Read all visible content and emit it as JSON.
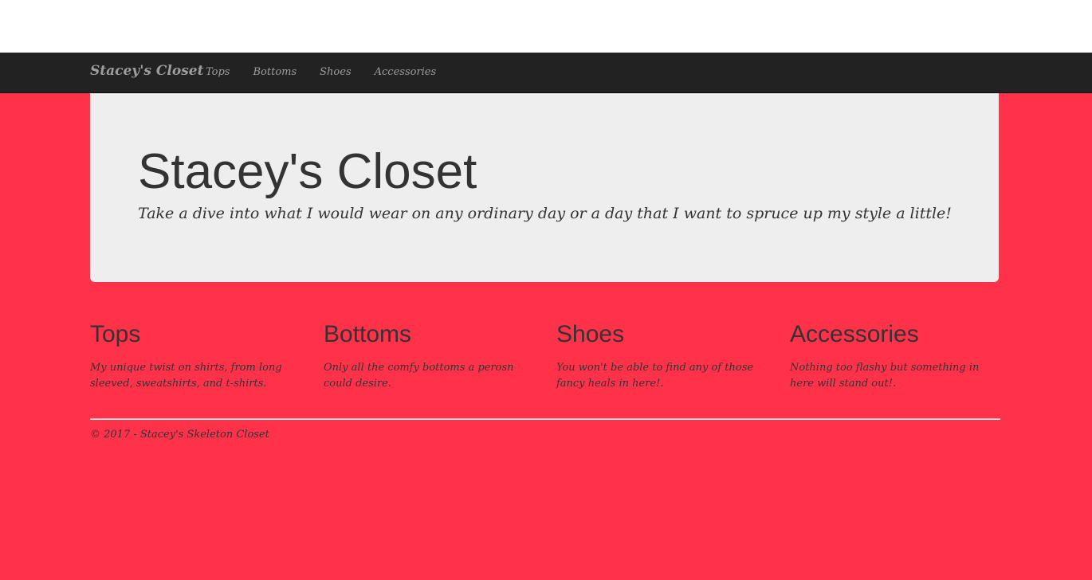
{
  "navbar": {
    "brand": "Stacey's Closet",
    "links": [
      {
        "label": "Tops"
      },
      {
        "label": "Bottoms"
      },
      {
        "label": "Shoes"
      },
      {
        "label": "Accessories"
      }
    ]
  },
  "jumbotron": {
    "title": "Stacey's Closet",
    "lead": "Take a dive into what I would wear on any ordinary day or a day that I want to spruce up my style a little!"
  },
  "categories": [
    {
      "heading": "Tops",
      "text": "My unique twist on shirts, from long sleeved, sweatshirts, and t-shirts."
    },
    {
      "heading": "Bottoms",
      "text": "Only all the comfy bottoms a perosn could desire."
    },
    {
      "heading": "Shoes",
      "text": "You won't be able to find any of those fancy heals in here!."
    },
    {
      "heading": "Accessories",
      "text": "Nothing too flashy but something in here will stand out!."
    }
  ],
  "footer": {
    "text": "© 2017 - Stacey's Skeleton Closet"
  },
  "colors": {
    "page_background": "#ff324a",
    "navbar_background": "#222222",
    "jumbotron_background": "#eeeeee",
    "text": "#333333",
    "nav_text": "#9d9d9d"
  }
}
